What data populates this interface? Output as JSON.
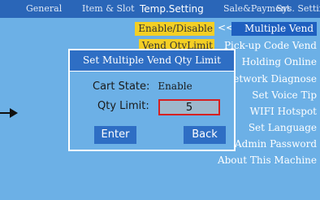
{
  "tabs": {
    "general": "General",
    "item_slot": "Item & Slot",
    "temp_setting": "Temp.Setting",
    "sale_payment": "Sale&Payment",
    "sys_setting": "Sys. Setting"
  },
  "menu": {
    "left_items": [
      "Enable/Disable",
      "Vend QtyLimit"
    ],
    "selection_marker": "<<",
    "right_items": [
      "Multiple Vend",
      "Pick-up Code Vend",
      "Holding Online",
      "Network Diagnose",
      "Set Voice Tip",
      "WIFI Hotspot",
      "Set Language",
      "Admin Password",
      "About This Machine"
    ]
  },
  "dialog": {
    "title": "Set Multiple Vend Qty Limit",
    "cart_state_label": "Cart State:",
    "cart_state_value": "Enable",
    "qty_limit_label": "Qty Limit:",
    "qty_limit_value": "5",
    "enter_label": "Enter",
    "back_label": "Back"
  },
  "colors": {
    "background": "#6cb0e6",
    "topbar": "#2a66b8",
    "highlight": "#f4cf24",
    "button": "#2e6ec4",
    "input_border": "#d62020"
  }
}
